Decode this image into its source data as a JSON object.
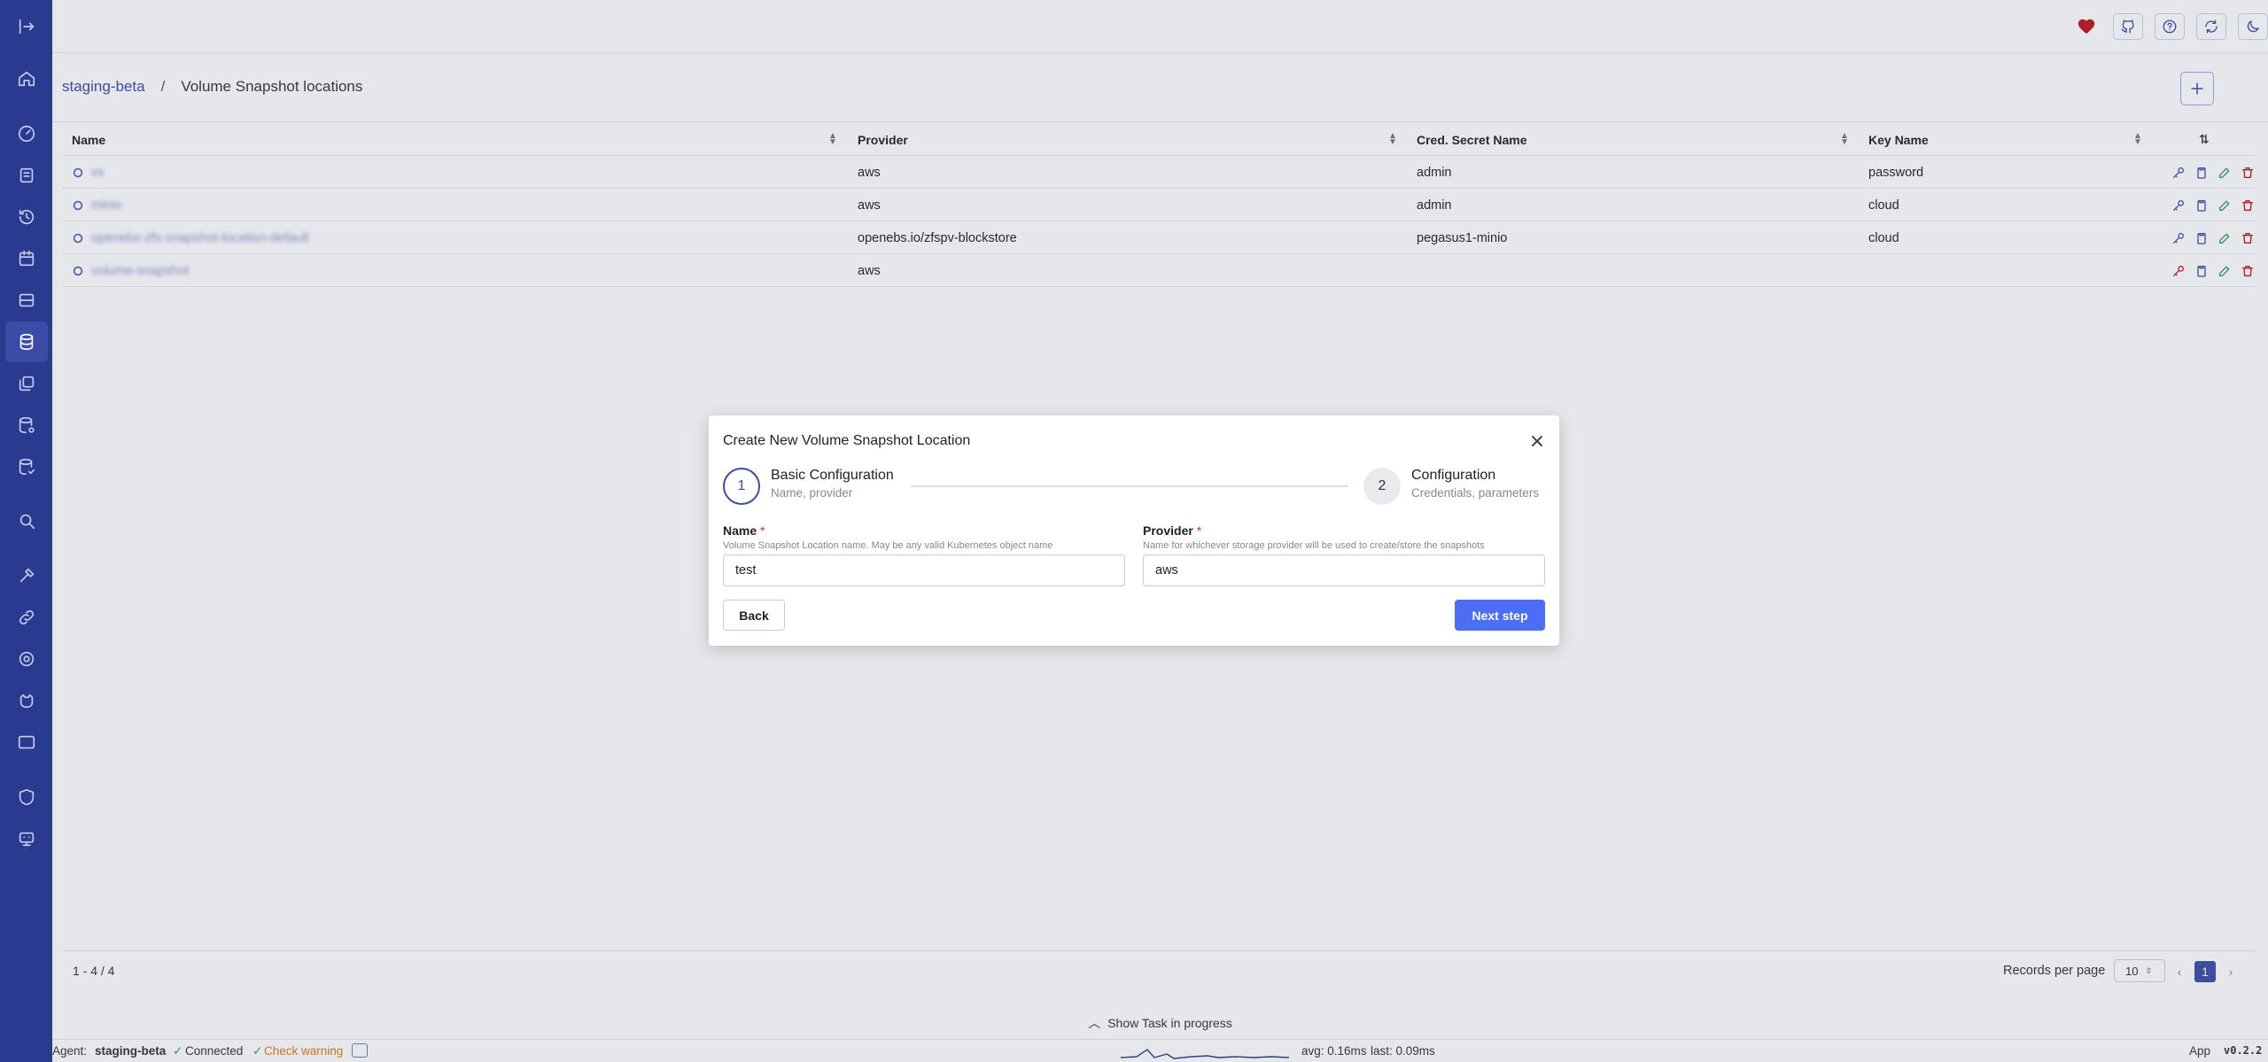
{
  "breadcrumb": {
    "cluster": "staging-beta",
    "separator": "/",
    "page": "Volume Snapshot locations"
  },
  "table": {
    "columns": [
      "Name",
      "Provider",
      "Cred. Secret Name",
      "Key Name"
    ],
    "rows": [
      {
        "name": "vs",
        "provider": "aws",
        "secret": "admin",
        "key": "password"
      },
      {
        "name": "minio",
        "provider": "aws",
        "secret": "admin",
        "key": "cloud"
      },
      {
        "name": "openebs-zfs-snapshot-location-default",
        "provider": "openebs.io/zfspv-blockstore",
        "secret": "pegasus1-minio",
        "key": "cloud"
      },
      {
        "name": "volume-snapshot",
        "provider": "aws",
        "secret": "",
        "key": ""
      }
    ]
  },
  "pagination": {
    "count": "1 - 4 / 4",
    "records_label": "Records per page",
    "per_page": "10",
    "current_page": "1"
  },
  "taskbar": {
    "label": "Show Task in progress"
  },
  "statusbar": {
    "agent_label": "Agent:",
    "agent_name": "staging-beta",
    "connected": "Connected",
    "warning": "Check warning",
    "avg": "avg: 0.16ms",
    "last": "last: 0.09ms",
    "app": "App",
    "version": "v0.2.2"
  },
  "modal": {
    "title": "Create New Volume Snapshot Location",
    "step1": {
      "number": "1",
      "label": "Basic Configuration",
      "desc": "Name, provider"
    },
    "step2": {
      "number": "2",
      "label": "Configuration",
      "desc": "Credentials, parameters"
    },
    "name_field": {
      "label": "Name",
      "required": "*",
      "desc": "Volume Snapshot Location name. May be any valid Kubernetes object name",
      "value": "test"
    },
    "provider_field": {
      "label": "Provider",
      "required": "*",
      "desc": "Name for whichever storage provider will be used to create/store the snapshots",
      "value": "aws"
    },
    "back_label": "Back",
    "next_label": "Next step"
  },
  "colors": {
    "sidebar": "#2b3a91",
    "accent": "#3b4ca8",
    "primary_button": "#4c6ef5",
    "danger": "#c0141e",
    "success": "#2e9e4f"
  }
}
